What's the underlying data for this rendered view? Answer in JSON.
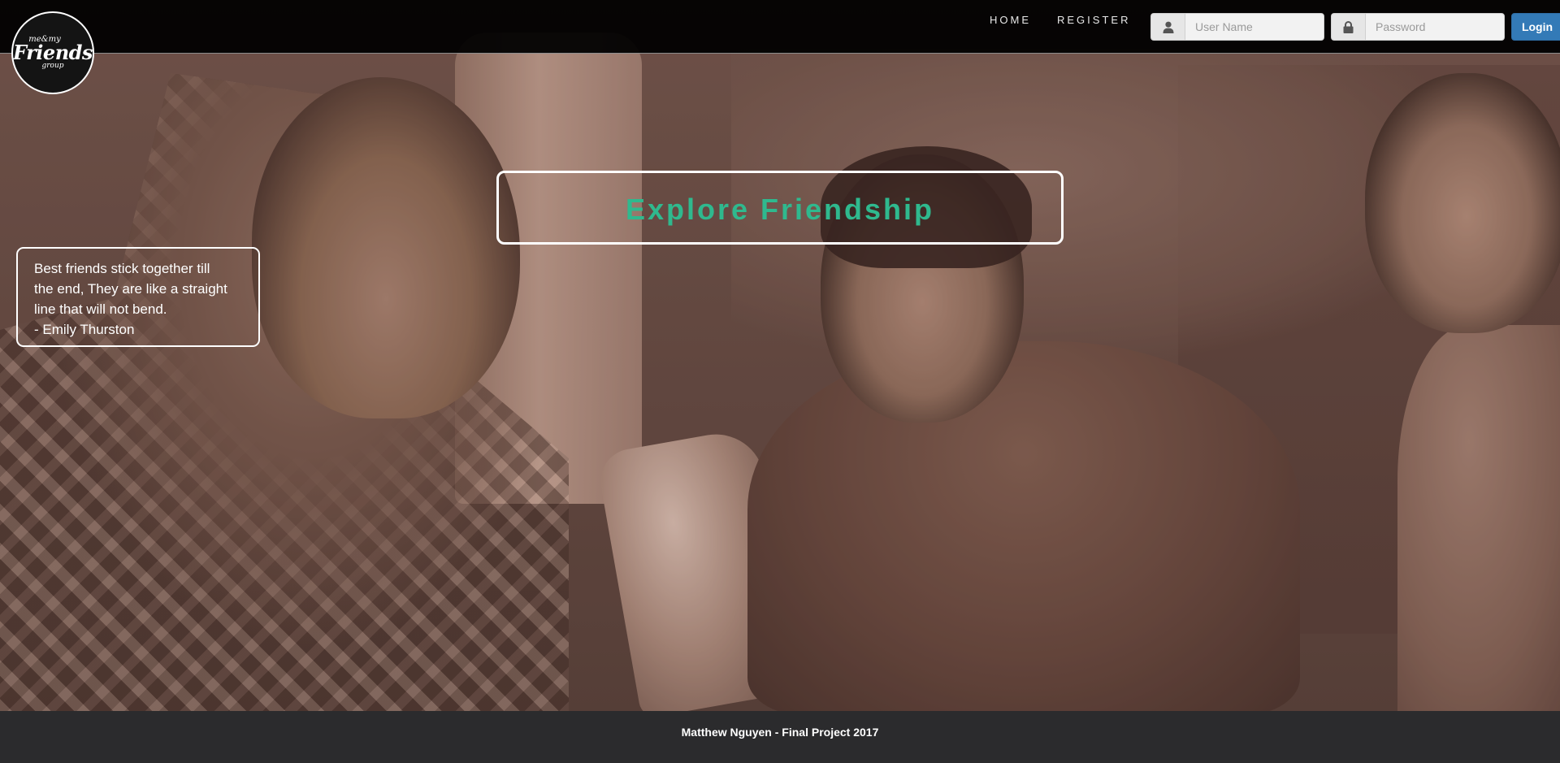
{
  "logo": {
    "top": "me&my",
    "main": "Friends",
    "bottom": "group"
  },
  "nav": {
    "links": [
      {
        "label": "HOME"
      },
      {
        "label": "REGISTER"
      }
    ]
  },
  "login": {
    "username_placeholder": "User Name",
    "username_value": "",
    "password_placeholder": "Password",
    "password_value": "",
    "button_label": "Login",
    "user_icon": "user-icon",
    "lock_icon": "lock-icon"
  },
  "hero": {
    "headline": "Explore Friendship",
    "headline_color": "#2fb98e",
    "quote": {
      "lines": [
        "Best friends stick together till",
        "the end, They are like a straight",
        "line that will not bend.",
        "- Emily Thurston"
      ]
    }
  },
  "footer": {
    "text": "Matthew Nguyen - Final Project 2017"
  },
  "colors": {
    "navbar_bg": "#000000",
    "login_button": "#337ab7",
    "footer_bg": "#2b2b2d"
  }
}
